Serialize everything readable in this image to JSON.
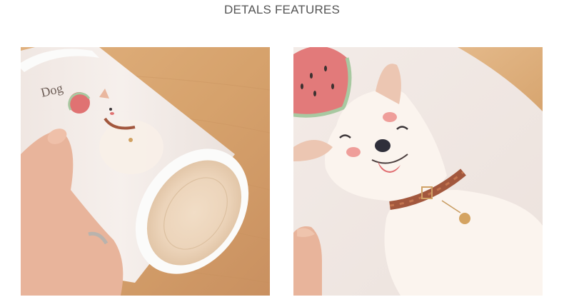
{
  "header": {
    "title": "DETALS FEATURES"
  },
  "photos": [
    {
      "alt": "Frosted cup with dog illustration held in hand",
      "label_text": "Dog"
    },
    {
      "alt": "Close-up of dog illustration with watermelon hat"
    }
  ],
  "colors": {
    "wood": "#d8a56f",
    "frosted": "#f4eeec",
    "rim": "#fbfbfa",
    "collar": "#a2573d",
    "watermelon": "#e07272",
    "skin": "#e9b79f"
  }
}
